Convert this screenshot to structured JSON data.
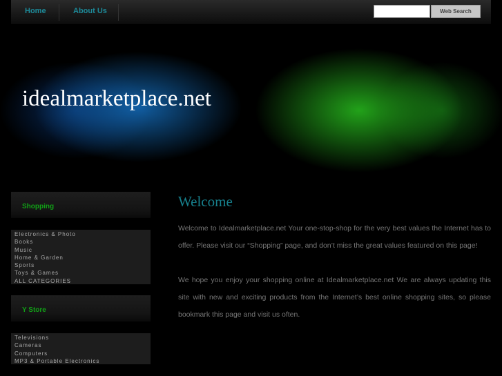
{
  "nav": {
    "items": [
      "Home",
      "About Us"
    ],
    "search_placeholder": "",
    "search_button": "Web Search"
  },
  "banner": {
    "site_title": "idealmarketplace.net"
  },
  "sidebar": {
    "shopping": {
      "title": "Shopping",
      "items": [
        "Electronics & Photo",
        "Books",
        "Music",
        "Home & Garden",
        "Sports",
        "Toys & Games",
        "ALL CATEGORIES"
      ]
    },
    "ystore": {
      "title": "Y Store",
      "items": [
        "Televisions",
        "Cameras",
        "Computers",
        "MP3 & Portable Electronics"
      ]
    }
  },
  "main": {
    "title": "Welcome",
    "paragraphs": [
      "Welcome to Idealmarketplace.net Your one-stop-shop for the very best values the Internet has to offer. Please visit our “Shopping” page, and don’t miss the great values featured on this page!",
      "We hope you enjoy your shopping online at Idealmarketplace.net We are always updating this site with new and exciting products from the Internet’s best online shopping sites, so please bookmark this page and visit us often."
    ]
  }
}
